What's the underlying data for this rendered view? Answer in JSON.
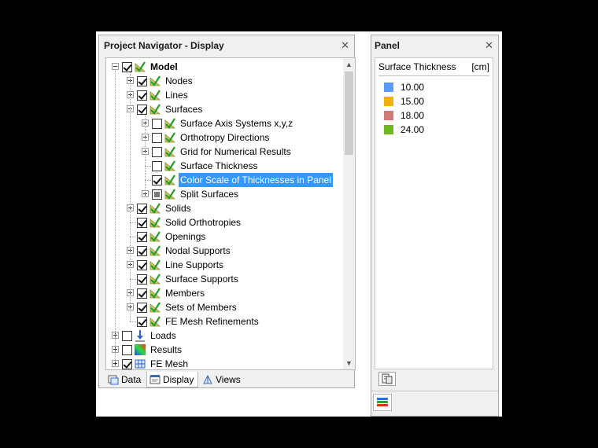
{
  "navigator": {
    "title": "Project Navigator - Display",
    "close_glyph": "✕",
    "tree": [
      {
        "label": "Model",
        "level": 0,
        "expander": "minus",
        "check": "checked",
        "icon": "model-check-icon",
        "bold": true
      },
      {
        "label": "Nodes",
        "level": 1,
        "expander": "plus",
        "check": "checked",
        "icon": "model-check-icon"
      },
      {
        "label": "Lines",
        "level": 1,
        "expander": "plus",
        "check": "checked",
        "icon": "model-check-icon"
      },
      {
        "label": "Surfaces",
        "level": 1,
        "expander": "minus",
        "check": "checked",
        "icon": "model-check-icon"
      },
      {
        "label": "Surface Axis Systems x,y,z",
        "level": 2,
        "expander": "plus",
        "check": "unchecked",
        "icon": "model-check-icon"
      },
      {
        "label": "Orthotropy Directions",
        "level": 2,
        "expander": "plus",
        "check": "unchecked",
        "icon": "model-check-icon"
      },
      {
        "label": "Grid for Numerical Results",
        "level": 2,
        "expander": "plus",
        "check": "unchecked",
        "icon": "model-check-icon"
      },
      {
        "label": "Surface Thickness",
        "level": 2,
        "expander": "none",
        "check": "unchecked",
        "icon": "model-check-icon"
      },
      {
        "label": "Color Scale of Thicknesses in Panel",
        "level": 2,
        "expander": "none",
        "check": "checked",
        "icon": "model-check-icon",
        "selected": true
      },
      {
        "label": "Split Surfaces",
        "level": 2,
        "expander": "plus",
        "check": "partial",
        "icon": "model-check-icon"
      },
      {
        "label": "Solids",
        "level": 1,
        "expander": "plus",
        "check": "checked",
        "icon": "model-check-icon"
      },
      {
        "label": "Solid Orthotropies",
        "level": 1,
        "expander": "none",
        "check": "checked",
        "icon": "model-check-icon"
      },
      {
        "label": "Openings",
        "level": 1,
        "expander": "none",
        "check": "checked",
        "icon": "model-check-icon"
      },
      {
        "label": "Nodal Supports",
        "level": 1,
        "expander": "plus",
        "check": "checked",
        "icon": "model-check-icon"
      },
      {
        "label": "Line Supports",
        "level": 1,
        "expander": "plus",
        "check": "checked",
        "icon": "model-check-icon"
      },
      {
        "label": "Surface Supports",
        "level": 1,
        "expander": "none",
        "check": "checked",
        "icon": "model-check-icon"
      },
      {
        "label": "Members",
        "level": 1,
        "expander": "plus",
        "check": "checked",
        "icon": "model-check-icon"
      },
      {
        "label": "Sets of Members",
        "level": 1,
        "expander": "plus",
        "check": "checked",
        "icon": "model-check-icon"
      },
      {
        "label": "FE Mesh Refinements",
        "level": 1,
        "expander": "none",
        "check": "checked",
        "icon": "model-check-icon"
      },
      {
        "label": "Loads",
        "level": 0,
        "expander": "plus",
        "check": "unchecked",
        "icon": "loads-arrow-icon"
      },
      {
        "label": "Results",
        "level": 0,
        "expander": "plus",
        "check": "unchecked",
        "icon": "results-gradient-icon"
      },
      {
        "label": "FE Mesh",
        "level": 0,
        "expander": "plus",
        "check": "checked",
        "icon": "fe-mesh-grid-icon"
      }
    ],
    "tabs": [
      {
        "label": "Data",
        "icon": "data-tab-icon",
        "active": false
      },
      {
        "label": "Display",
        "icon": "display-tab-icon",
        "active": true
      },
      {
        "label": "Views",
        "icon": "views-tab-icon",
        "active": false
      }
    ]
  },
  "panel": {
    "title": "Panel",
    "close_glyph": "✕",
    "header": "Surface Thickness",
    "unit": "[cm]",
    "legend": [
      {
        "value": "10.00",
        "color": "#5b9bff"
      },
      {
        "value": "15.00",
        "color": "#f0b400"
      },
      {
        "value": "18.00",
        "color": "#d07a7a"
      },
      {
        "value": "24.00",
        "color": "#6eb81e"
      }
    ]
  }
}
